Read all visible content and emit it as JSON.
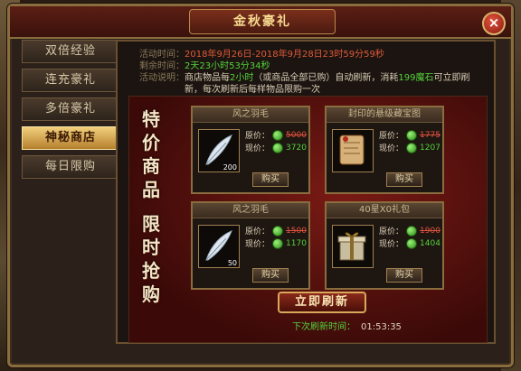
{
  "window": {
    "title": "金秋豪礼"
  },
  "sidebar": {
    "items": [
      {
        "label": "双倍经验",
        "active": false
      },
      {
        "label": "连充豪礼",
        "active": false
      },
      {
        "label": "多倍豪礼",
        "active": false
      },
      {
        "label": "神秘商店",
        "active": true
      },
      {
        "label": "每日限购",
        "active": false
      }
    ]
  },
  "info": {
    "time_label": "活动时间：",
    "time_value": "2018年9月26日-2018年9月28日23时59分59秒",
    "remain_label": "剩余时间：",
    "remain_value": "2天23小时53分34秒",
    "desc_label": "活动说明：",
    "desc_1": "商店物品每",
    "desc_hl1": "2小时",
    "desc_2": "（或商品全部已购）自动刷新，消耗",
    "desc_hl2": "199魔石",
    "desc_3": "可立即刷新，每次刷新后每样物品限购一次"
  },
  "promo_text": [
    "特",
    "价",
    "商",
    "品",
    "",
    "限",
    "时",
    "抢",
    "购"
  ],
  "price_labels": {
    "orig": "原价：",
    "now": "现价：",
    "buy": "购买"
  },
  "items": [
    {
      "name": "风之羽毛",
      "qty": "200",
      "orig": "5000",
      "now": "3720"
    },
    {
      "name": "封印的悬级藏宝图",
      "qty": "",
      "orig": "1775",
      "now": "1207"
    },
    {
      "name": "风之羽毛",
      "qty": "50",
      "orig": "1500",
      "now": "1170"
    },
    {
      "name": "40星X0礼包",
      "qty": "",
      "orig": "1900",
      "now": "1404"
    }
  ],
  "refresh_label": "立即刷新",
  "next_refresh": {
    "label": "下次刷新时间：",
    "time": "01:53:35"
  },
  "colors": {
    "accent_gold": "#f1cf7c",
    "price_green": "#54d23c",
    "price_red": "#e0523d"
  },
  "icons": {
    "close": "close-icon",
    "currency": "green-gem-icon"
  }
}
